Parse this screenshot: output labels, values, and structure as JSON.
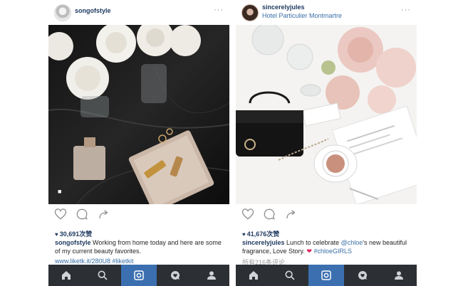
{
  "posts": [
    {
      "username": "songofstyle",
      "location": "",
      "more": "···",
      "likes": "30,691次赞",
      "caption_text": " Working from home today and here are some of my current beauty favorites.",
      "extra_line": "www.liketk.it/280U8 #liketkit",
      "tag_icon": "person-tag-icon"
    },
    {
      "username": "sincerelyjules",
      "location": "Hotel Particulier Montmartre",
      "more": "···",
      "likes": "41,676次赞",
      "caption_text_a": " Lunch to celebrate ",
      "caption_mention": "@chloe",
      "caption_text_b": "'s new beautiful fragrance, Love Story. ",
      "caption_heart": "❤",
      "caption_hashtag": " #chloeGIRLS",
      "extra_line": "所有216条评论"
    }
  ],
  "tabbar": {
    "tabs": [
      "home-icon",
      "search-icon",
      "camera-icon",
      "activity-icon",
      "profile-icon"
    ],
    "active_index": 2
  },
  "colors": {
    "tabbar_bg": "#2c2f33",
    "tab_active": "#3b6fb0",
    "username": "#1f3a60",
    "link": "#3a6fa8"
  }
}
